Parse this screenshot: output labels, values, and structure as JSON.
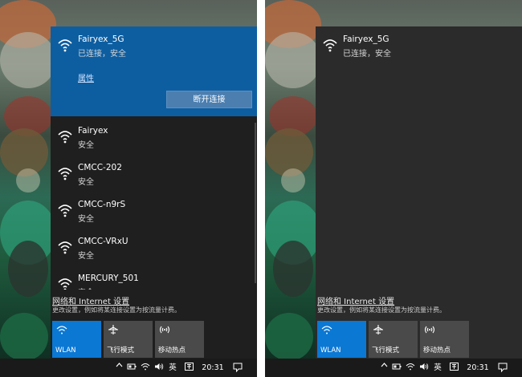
{
  "left": {
    "connected": {
      "ssid": "Fairyex_5G",
      "status": "已连接，安全",
      "properties_label": "属性",
      "disconnect_label": "断开连接"
    },
    "networks": [
      {
        "ssid": "Fairyex",
        "status": "安全"
      },
      {
        "ssid": "CMCC-202",
        "status": "安全"
      },
      {
        "ssid": "CMCC-n9rS",
        "status": "安全"
      },
      {
        "ssid": "CMCC-VRxU",
        "status": "安全"
      },
      {
        "ssid": "MERCURY_501",
        "status": "安全"
      }
    ],
    "settings_link": "网络和 Internet 设置",
    "settings_desc": "更改设置，例如将某连接设置为按流量计费。",
    "tiles": [
      {
        "label": "WLAN",
        "icon": "wifi-icon",
        "active": true
      },
      {
        "label": "飞行模式",
        "icon": "airplane-icon",
        "active": false
      },
      {
        "label": "移动热点",
        "icon": "hotspot-icon",
        "active": false
      }
    ]
  },
  "right": {
    "connected": {
      "ssid": "Fairyex_5G",
      "status": "已连接，安全"
    },
    "settings_link": "网络和 Internet 设置",
    "settings_desc": "更改设置，例如将某连接设置为按流量计费。",
    "tiles": [
      {
        "label": "WLAN",
        "icon": "wifi-icon",
        "active": true
      },
      {
        "label": "飞行模式",
        "icon": "airplane-icon",
        "active": false
      },
      {
        "label": "移动热点",
        "icon": "hotspot-icon",
        "active": false
      }
    ]
  },
  "taskbar": {
    "ime_label": "英",
    "time": "20:31"
  },
  "colors": {
    "accent": "#0b78d4",
    "connected_bg": "#0d5ea1",
    "panel_bg": "#1f1f1f",
    "tile_bg": "#4a4a4a"
  }
}
